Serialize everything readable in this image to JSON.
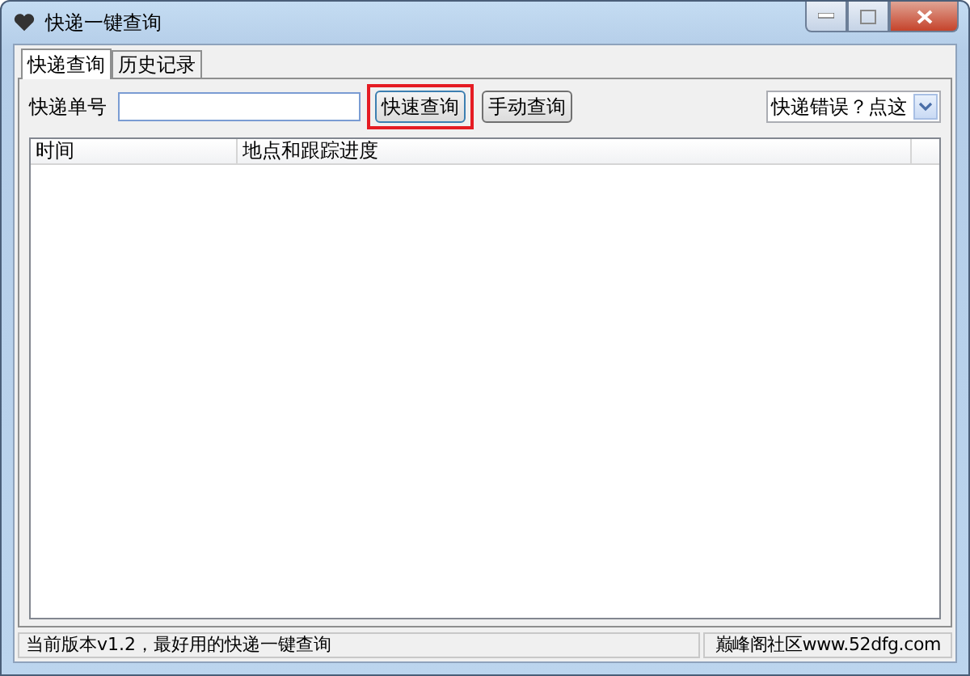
{
  "window": {
    "title": "快递一键查询"
  },
  "tabs": [
    {
      "label": "快递查询",
      "selected": true
    },
    {
      "label": "历史记录",
      "selected": false
    }
  ],
  "tracking_field": {
    "label": "快递单号"
  },
  "buttons": [
    {
      "label": "快速查询",
      "highlighted": true
    },
    {
      "label": "手动查询",
      "highlighted": false
    }
  ],
  "dropdown": {
    "value": "快递错误？点这"
  },
  "table": {
    "columns": [
      "时间",
      "地点和跟踪进度"
    ]
  },
  "status_bar": [
    "当前版本v1.2，最好用的快递一键查询",
    "巅峰阁社区www.52dfg.com"
  ]
}
